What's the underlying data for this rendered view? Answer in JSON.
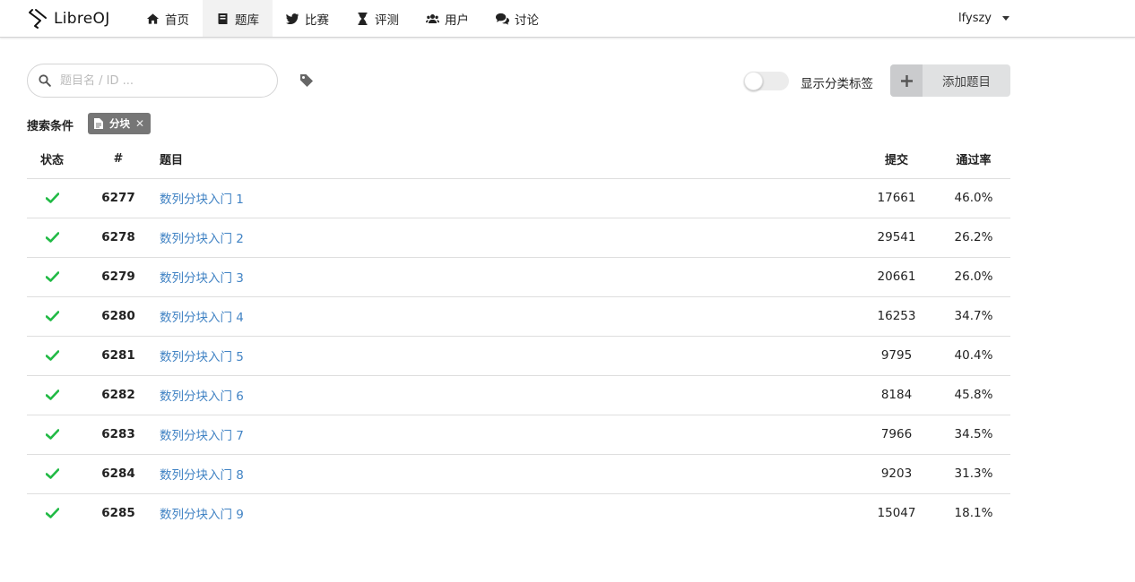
{
  "brand": {
    "name": "LibreOJ"
  },
  "nav": [
    {
      "label": "首页",
      "icon": "home-icon"
    },
    {
      "label": "题库",
      "icon": "book-icon",
      "active": true
    },
    {
      "label": "比赛",
      "icon": "twitter-bird-icon"
    },
    {
      "label": "评测",
      "icon": "hourglass-icon"
    },
    {
      "label": "用户",
      "icon": "users-icon"
    },
    {
      "label": "讨论",
      "icon": "comments-icon"
    }
  ],
  "user": {
    "name": "lfyszy"
  },
  "search": {
    "placeholder": "题目名 / ID ...",
    "value": ""
  },
  "toolbar": {
    "toggle_label": "显示分类标签",
    "toggle_on": false,
    "add_label": "添加题目"
  },
  "filter": {
    "title": "搜索条件",
    "tags": [
      {
        "label": "分块"
      }
    ]
  },
  "table": {
    "headers": {
      "status": "状态",
      "id": "#",
      "title": "题目",
      "submissions": "提交",
      "rate": "通过率"
    },
    "rows": [
      {
        "id": "6277",
        "title": "数列分块入门 1",
        "submissions": "17661",
        "rate": "46.0%",
        "accepted": true
      },
      {
        "id": "6278",
        "title": "数列分块入门 2",
        "submissions": "29541",
        "rate": "26.2%",
        "accepted": true
      },
      {
        "id": "6279",
        "title": "数列分块入门 3",
        "submissions": "20661",
        "rate": "26.0%",
        "accepted": true
      },
      {
        "id": "6280",
        "title": "数列分块入门 4",
        "submissions": "16253",
        "rate": "34.7%",
        "accepted": true
      },
      {
        "id": "6281",
        "title": "数列分块入门 5",
        "submissions": "9795",
        "rate": "40.4%",
        "accepted": true
      },
      {
        "id": "6282",
        "title": "数列分块入门 6",
        "submissions": "8184",
        "rate": "45.8%",
        "accepted": true
      },
      {
        "id": "6283",
        "title": "数列分块入门 7",
        "submissions": "7966",
        "rate": "34.5%",
        "accepted": true
      },
      {
        "id": "6284",
        "title": "数列分块入门 8",
        "submissions": "9203",
        "rate": "31.3%",
        "accepted": true
      },
      {
        "id": "6285",
        "title": "数列分块入门 9",
        "submissions": "15047",
        "rate": "18.1%",
        "accepted": true
      }
    ]
  },
  "colors": {
    "link": "#4183c4",
    "accepted": "#21ba45",
    "tag_bg": "#767676"
  }
}
